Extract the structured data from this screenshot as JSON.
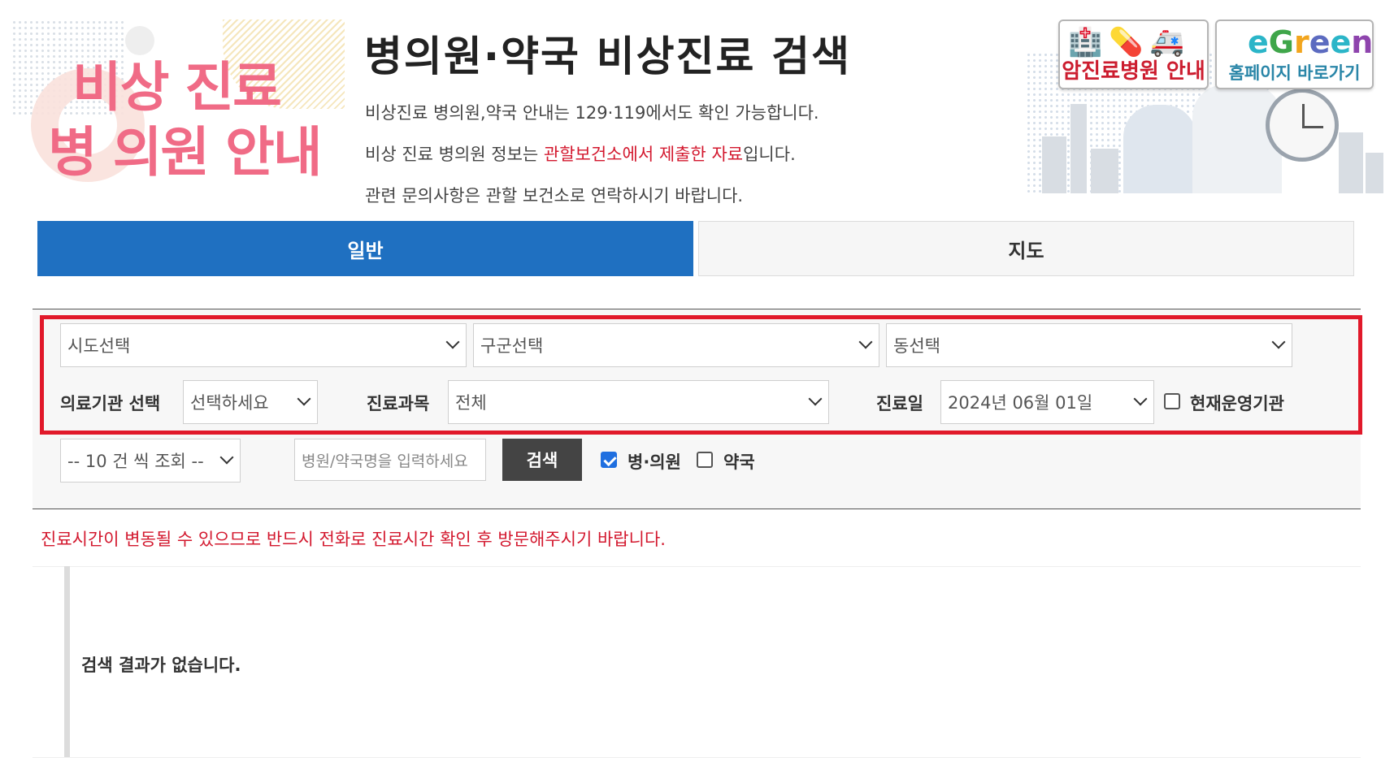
{
  "header": {
    "logo_line1": "비상 진료",
    "logo_line2": "병 의원 안내",
    "title": "병의원·약국 비상진료 검색",
    "intro_line1": "비상진료 병의원,약국 안내는 129·119에서도 확인 가능합니다.",
    "intro_line2_before": "비상 진료 병의원 정보는 ",
    "intro_line2_red": "관할보건소에서 제출한 자료",
    "intro_line2_after": "입니다.",
    "intro_line3": "관련 문의사항은 관할 보건소로 연락하시기 바랍니다.",
    "promo_cancer": "암진료병원 안내",
    "promo_homepage": "홈페이지 바로가기",
    "promo_icons": "🏥💊🚑"
  },
  "tabs": [
    {
      "label": "일반",
      "active": true
    },
    {
      "label": "지도",
      "active": false
    }
  ],
  "filters": {
    "sido": "시도선택",
    "gugun": "구군선택",
    "dong": "동선택",
    "institution_label": "의료기관 선택",
    "institution_value": "선택하세요",
    "department_label": "진료과목",
    "department_value": "전체",
    "date_label": "진료일",
    "date_value": "2024년 06월 01일",
    "operating_label": "현재운영기관",
    "operating_checked": false
  },
  "search": {
    "page_size": "-- 10 건 씩 조회 --",
    "name_placeholder": "병원/약국명을 입력하세요",
    "button": "검색",
    "hospital_label": "병·의원",
    "hospital_checked": true,
    "pharmacy_label": "약국",
    "pharmacy_checked": false
  },
  "notice": "진료시간이 변동될 수 있으므로 반드시 전화로 진료시간 확인 후 방문해주시기 바랍니다.",
  "results": {
    "empty_message": "검색 결과가 없습니다."
  },
  "colors": {
    "primary": "#1f70c1",
    "highlight_border": "#e1192a",
    "notice": "#d3182e",
    "logo_pink": "#f06b86"
  }
}
